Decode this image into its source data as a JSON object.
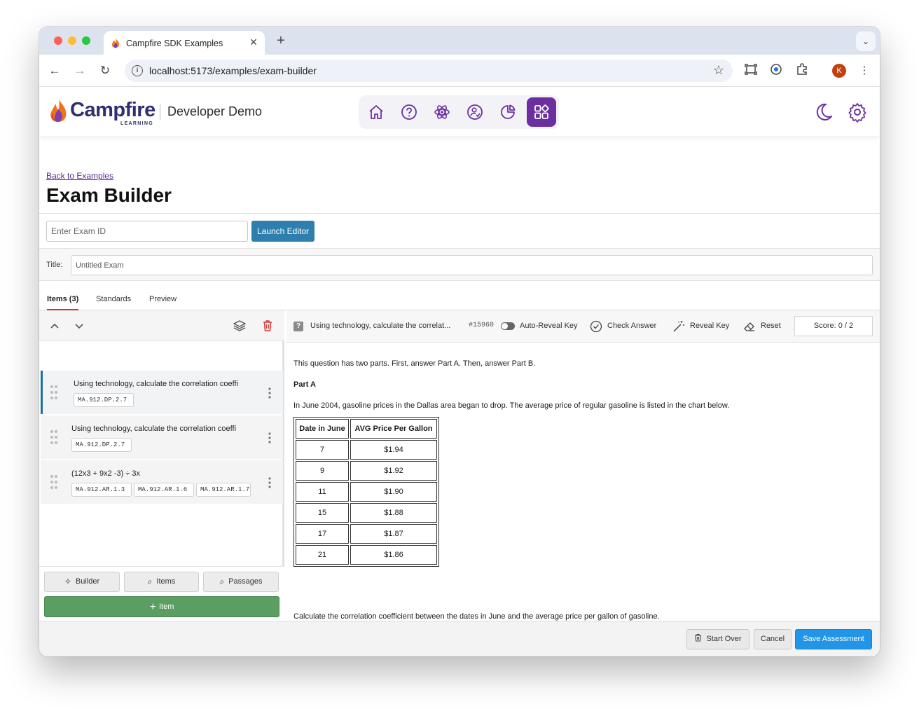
{
  "browser": {
    "tab_title": "Campfire SDK Examples",
    "url": "localhost:5173/examples/exam-builder",
    "profile_initial": "K"
  },
  "header": {
    "logo_text": "Campfire",
    "logo_sub": "LEARNING",
    "subtitle": "Developer Demo",
    "nav_icons": [
      "home-icon",
      "help-icon",
      "atom-icon",
      "user-check-icon",
      "pie-chart-icon",
      "apps-grid-icon"
    ],
    "active_nav": "apps-grid-icon",
    "accent_color": "#6b2fa0"
  },
  "page": {
    "back_link": "Back to Examples",
    "title": "Exam Builder",
    "exam_id_placeholder": "Enter Exam ID",
    "launch_label": "Launch Editor",
    "title_label": "Title:",
    "title_placeholder": "Untitled Exam"
  },
  "tabs": [
    {
      "label": "Items (3)",
      "active": true
    },
    {
      "label": "Standards",
      "active": false
    },
    {
      "label": "Preview",
      "active": false
    }
  ],
  "items": [
    {
      "text": "Using technology, calculate the correlation coeffi",
      "tags": [
        "MA.912.DP.2.7"
      ],
      "selected": true
    },
    {
      "text": "Using technology, calculate the correlation coeffi",
      "tags": [
        "MA.912.DP.2.7"
      ],
      "selected": false
    },
    {
      "text": "(12x3 + 9x2 -3) ÷ 3x",
      "tags": [
        "MA.912.AR.1.3",
        "MA.912.AR.1.6",
        "MA.912.AR.1.7"
      ],
      "selected": false
    }
  ],
  "left_footer": {
    "builder": "Builder",
    "items": "Items",
    "passages": "Passages",
    "add_item": "Item"
  },
  "question_toolbar": {
    "title": "Using technology, calculate the correlat...",
    "id": "#15960",
    "auto_reveal": "Auto-Reveal Key",
    "check_answer": "Check Answer",
    "reveal_key": "Reveal Key",
    "reset": "Reset",
    "score": "Score: 0 / 2"
  },
  "question": {
    "intro": "This question has two parts. First, answer Part A. Then, answer Part B.",
    "part_a": "Part A",
    "context": "In June 2004, gasoline prices in the Dallas area began to drop. The average price of regular gasoline is listed in the chart below.",
    "table_headers": [
      "Date in June",
      "AVG Price Per Gallon"
    ],
    "table_rows": [
      [
        "7",
        "$1.94"
      ],
      [
        "9",
        "$1.92"
      ],
      [
        "11",
        "$1.90"
      ],
      [
        "15",
        "$1.88"
      ],
      [
        "17",
        "$1.87"
      ],
      [
        "21",
        "$1.86"
      ]
    ],
    "prompt": "Calculate the correlation coefficient between the dates in June and the average price per gallon of gasoline."
  },
  "footer": {
    "start_over": "Start Over",
    "cancel": "Cancel",
    "save": "Save Assessment"
  }
}
